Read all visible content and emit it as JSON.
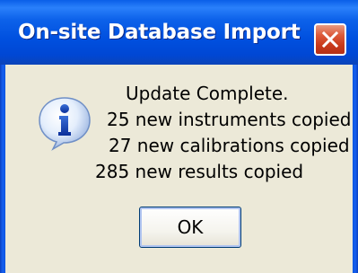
{
  "window": {
    "title": "On-site Database Import"
  },
  "message": {
    "lines": [
      "Update Complete.",
      "25 new instruments copied",
      "27 new calibrations copied",
      "285 new results copied"
    ],
    "icon": "info-icon"
  },
  "buttons": {
    "ok_label": "OK",
    "close_icon": "close-icon"
  },
  "colors": {
    "titlebar": "#0054e3",
    "close_button": "#dd5a3a",
    "dialog_background": "#ece9d8"
  }
}
